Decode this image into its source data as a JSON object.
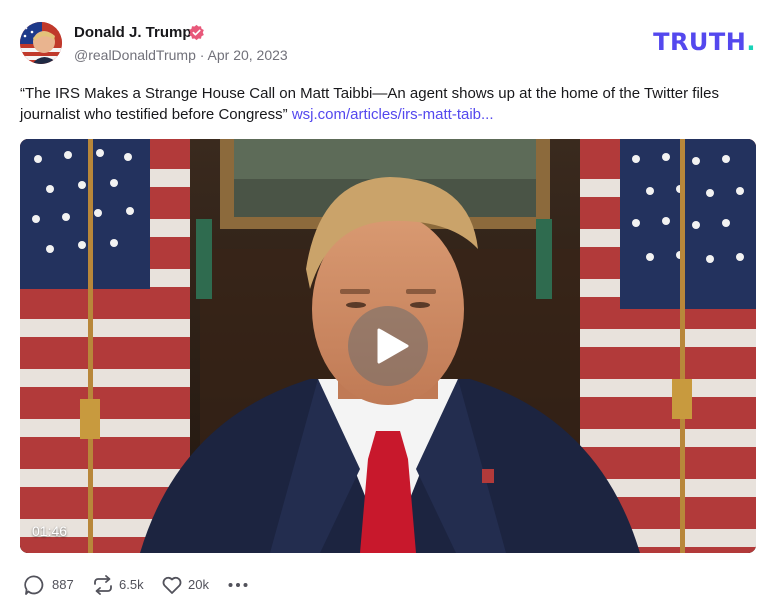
{
  "author": {
    "name": "Donald J. Trump",
    "handle": "@realDonaldTrump",
    "date": "Apr 20, 2023",
    "verified": true
  },
  "brand": {
    "logo_text": "TRUTH",
    "logo_dot": ".",
    "accent_color": "#5448ee",
    "dot_color": "#19d3b8"
  },
  "status": {
    "text": "“The IRS Makes a Strange House Call on Matt Taibbi—An agent shows up at the home of the Twitter files journalist who testified before Congress”",
    "link": "wsj.com/articles/irs-matt-taib..."
  },
  "video": {
    "duration": "01:46",
    "play_icon": "play-icon"
  },
  "actions": {
    "replies": "887",
    "retruths": "6.5k",
    "likes": "20k",
    "more_icon": "more-icon"
  }
}
